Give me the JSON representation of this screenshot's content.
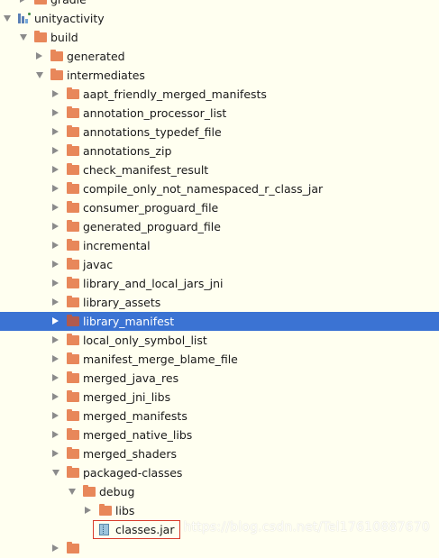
{
  "colors": {
    "background": "#fffff0",
    "selection": "#3b73d3",
    "folder": "#e8875a",
    "highlight_box": "#d93c2c"
  },
  "tree": [
    {
      "label": "gradle",
      "level": 1,
      "icon": "folder-icon",
      "arrow": "right",
      "partial": true
    },
    {
      "label": "unityactivity",
      "level": 0,
      "icon": "module-icon",
      "arrow": "down"
    },
    {
      "label": "build",
      "level": 1,
      "icon": "folder-icon",
      "arrow": "down"
    },
    {
      "label": "generated",
      "level": 2,
      "icon": "folder-icon",
      "arrow": "right"
    },
    {
      "label": "intermediates",
      "level": 2,
      "icon": "folder-icon",
      "arrow": "down"
    },
    {
      "label": "aapt_friendly_merged_manifests",
      "level": 3,
      "icon": "folder-icon",
      "arrow": "right"
    },
    {
      "label": "annotation_processor_list",
      "level": 3,
      "icon": "folder-icon",
      "arrow": "right"
    },
    {
      "label": "annotations_typedef_file",
      "level": 3,
      "icon": "folder-icon",
      "arrow": "right"
    },
    {
      "label": "annotations_zip",
      "level": 3,
      "icon": "folder-icon",
      "arrow": "right"
    },
    {
      "label": "check_manifest_result",
      "level": 3,
      "icon": "folder-icon",
      "arrow": "right"
    },
    {
      "label": "compile_only_not_namespaced_r_class_jar",
      "level": 3,
      "icon": "folder-icon",
      "arrow": "right"
    },
    {
      "label": "consumer_proguard_file",
      "level": 3,
      "icon": "folder-icon",
      "arrow": "right"
    },
    {
      "label": "generated_proguard_file",
      "level": 3,
      "icon": "folder-icon",
      "arrow": "right"
    },
    {
      "label": "incremental",
      "level": 3,
      "icon": "folder-icon",
      "arrow": "right"
    },
    {
      "label": "javac",
      "level": 3,
      "icon": "folder-icon",
      "arrow": "right"
    },
    {
      "label": "library_and_local_jars_jni",
      "level": 3,
      "icon": "folder-icon",
      "arrow": "right"
    },
    {
      "label": "library_assets",
      "level": 3,
      "icon": "folder-icon",
      "arrow": "right"
    },
    {
      "label": "library_manifest",
      "level": 3,
      "icon": "folder-icon",
      "arrow": "right",
      "selected": true
    },
    {
      "label": "local_only_symbol_list",
      "level": 3,
      "icon": "folder-icon",
      "arrow": "right"
    },
    {
      "label": "manifest_merge_blame_file",
      "level": 3,
      "icon": "folder-icon",
      "arrow": "right"
    },
    {
      "label": "merged_java_res",
      "level": 3,
      "icon": "folder-icon",
      "arrow": "right"
    },
    {
      "label": "merged_jni_libs",
      "level": 3,
      "icon": "folder-icon",
      "arrow": "right"
    },
    {
      "label": "merged_manifests",
      "level": 3,
      "icon": "folder-icon",
      "arrow": "right"
    },
    {
      "label": "merged_native_libs",
      "level": 3,
      "icon": "folder-icon",
      "arrow": "right"
    },
    {
      "label": "merged_shaders",
      "level": 3,
      "icon": "folder-icon",
      "arrow": "right"
    },
    {
      "label": "packaged-classes",
      "level": 3,
      "icon": "folder-icon",
      "arrow": "down"
    },
    {
      "label": "debug",
      "level": 4,
      "icon": "folder-icon",
      "arrow": "down"
    },
    {
      "label": "libs",
      "level": 5,
      "icon": "folder-icon",
      "arrow": "right"
    },
    {
      "label": "classes.jar",
      "level": 5,
      "icon": "jar-icon",
      "arrow": "none",
      "highlighted": true
    },
    {
      "label": "",
      "level": 3,
      "icon": "folder-icon",
      "arrow": "right",
      "partial": true
    }
  ],
  "watermark": "https://blog.csdn.net/Tel17610887670"
}
